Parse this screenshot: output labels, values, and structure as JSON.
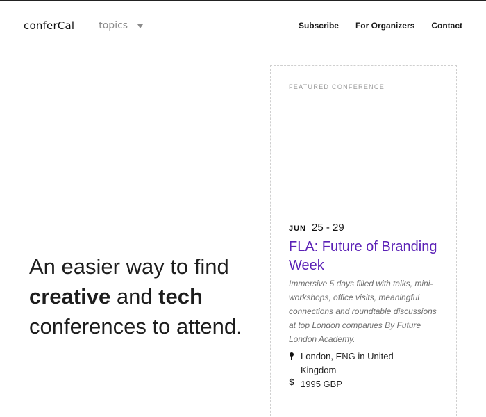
{
  "header": {
    "logo": "conferCal",
    "topics_label": "topics",
    "nav": [
      "Subscribe",
      "For Organizers",
      "Contact"
    ]
  },
  "hero": {
    "line1": "An easier way to find",
    "bold1": "creative",
    "mid": " and ",
    "bold2": "tech",
    "line3": "conferences to attend."
  },
  "featured": {
    "label": "FEATURED CONFERENCE",
    "month": "JUN",
    "days": "25 - 29",
    "title": "FLA: Future of Branding Week",
    "description": "Immersive 5 days filled with talks, mini-workshops, office visits, meaningful connections and roundtable discussions at top London companies By Future London Academy.",
    "location": "London, ENG in United Kingdom",
    "price": "1995 GBP"
  },
  "colors": {
    "accent": "#5b21b6",
    "muted": "#8a8a8a"
  },
  "icons": [
    "chevron-down-icon",
    "map-pin-icon",
    "dollar-icon"
  ]
}
